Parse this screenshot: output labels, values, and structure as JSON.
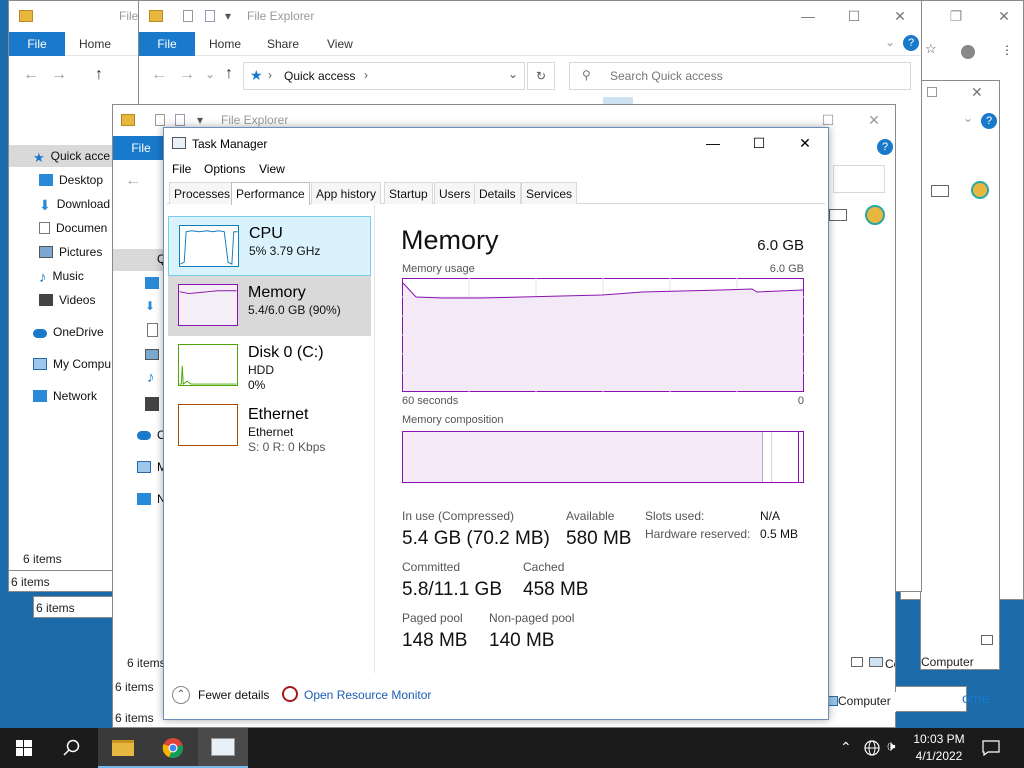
{
  "background_windows": {
    "window_a": {
      "title": "File",
      "ribbon": {
        "file": "File",
        "home": "Home"
      },
      "nav": [
        "Quick acce",
        "Desktop",
        "Download",
        "Documen",
        "Pictures",
        "Music",
        "Videos",
        "OneDrive",
        "My Compu",
        "Network"
      ],
      "status_items": "6 items",
      "status_items_2": "6 items",
      "status_items_3": "6 items"
    },
    "window_b": {
      "title": "File Explorer",
      "ribbon": {
        "file": "File",
        "home": "Home",
        "share": "Share",
        "view": "View"
      },
      "address": "Quick access",
      "search_placeholder": "Search Quick access"
    },
    "window_c": {
      "title": "File Explorer",
      "ribbon": {
        "file": "File"
      },
      "nav_letters": [
        "Q",
        "O",
        "M",
        "N"
      ],
      "status_items": "6 items",
      "status_items_2": "6 items",
      "status_items_3": "6 items"
    },
    "window_right": {
      "status_computer": "Computer",
      "status_computer_2": "Computer",
      "status_home": "ome",
      "status_computer_3": "Computer"
    }
  },
  "task_manager": {
    "title": "Task Manager",
    "menu": [
      "File",
      "Options",
      "View"
    ],
    "tabs": [
      "Processes",
      "Performance",
      "App history",
      "Startup",
      "Users",
      "Details",
      "Services"
    ],
    "active_tab": "Performance",
    "resources": [
      {
        "name": "CPU",
        "line1": "5%  3.79 GHz",
        "line2": "",
        "color": "#117dbb"
      },
      {
        "name": "Memory",
        "line1": "5.4/6.0 GB (90%)",
        "line2": "",
        "color": "#8b12ae"
      },
      {
        "name": "Disk 0 (C:)",
        "line1": "HDD",
        "line2": "0%",
        "color": "#4da60c"
      },
      {
        "name": "Ethernet",
        "line1": "Ethernet",
        "line2": "S: 0 R: 0 Kbps",
        "color": "#a74f01"
      }
    ],
    "memory_panel": {
      "heading": "Memory",
      "total": "6.0 GB",
      "usage_label": "Memory usage",
      "usage_max": "6.0 GB",
      "time_left": "60 seconds",
      "time_right": "0",
      "composition_label": "Memory composition",
      "in_use_fraction": 0.9,
      "stats": {
        "in_use_label": "In use (Compressed)",
        "in_use_value": "5.4 GB (70.2 MB)",
        "available_label": "Available",
        "available_value": "580 MB",
        "committed_label": "Committed",
        "committed_value": "5.8/11.1 GB",
        "cached_label": "Cached",
        "cached_value": "458 MB",
        "paged_label": "Paged pool",
        "paged_value": "148 MB",
        "nonpaged_label": "Non-paged pool",
        "nonpaged_value": "140 MB",
        "slots_label": "Slots used:",
        "slots_value": "N/A",
        "hw_label": "Hardware reserved:",
        "hw_value": "0.5 MB"
      }
    },
    "footer": {
      "fewer_details": "Fewer details",
      "resource_monitor": "Open Resource Monitor"
    }
  },
  "taskbar": {
    "time": "10:03 PM",
    "date": "4/1/2022"
  },
  "colors": {
    "memory_purple": "#8b12ae",
    "cpu_blue": "#117dbb",
    "disk_green": "#4da60c",
    "ethernet_brown": "#a74f01",
    "selected_bg": "#cce8ff"
  }
}
